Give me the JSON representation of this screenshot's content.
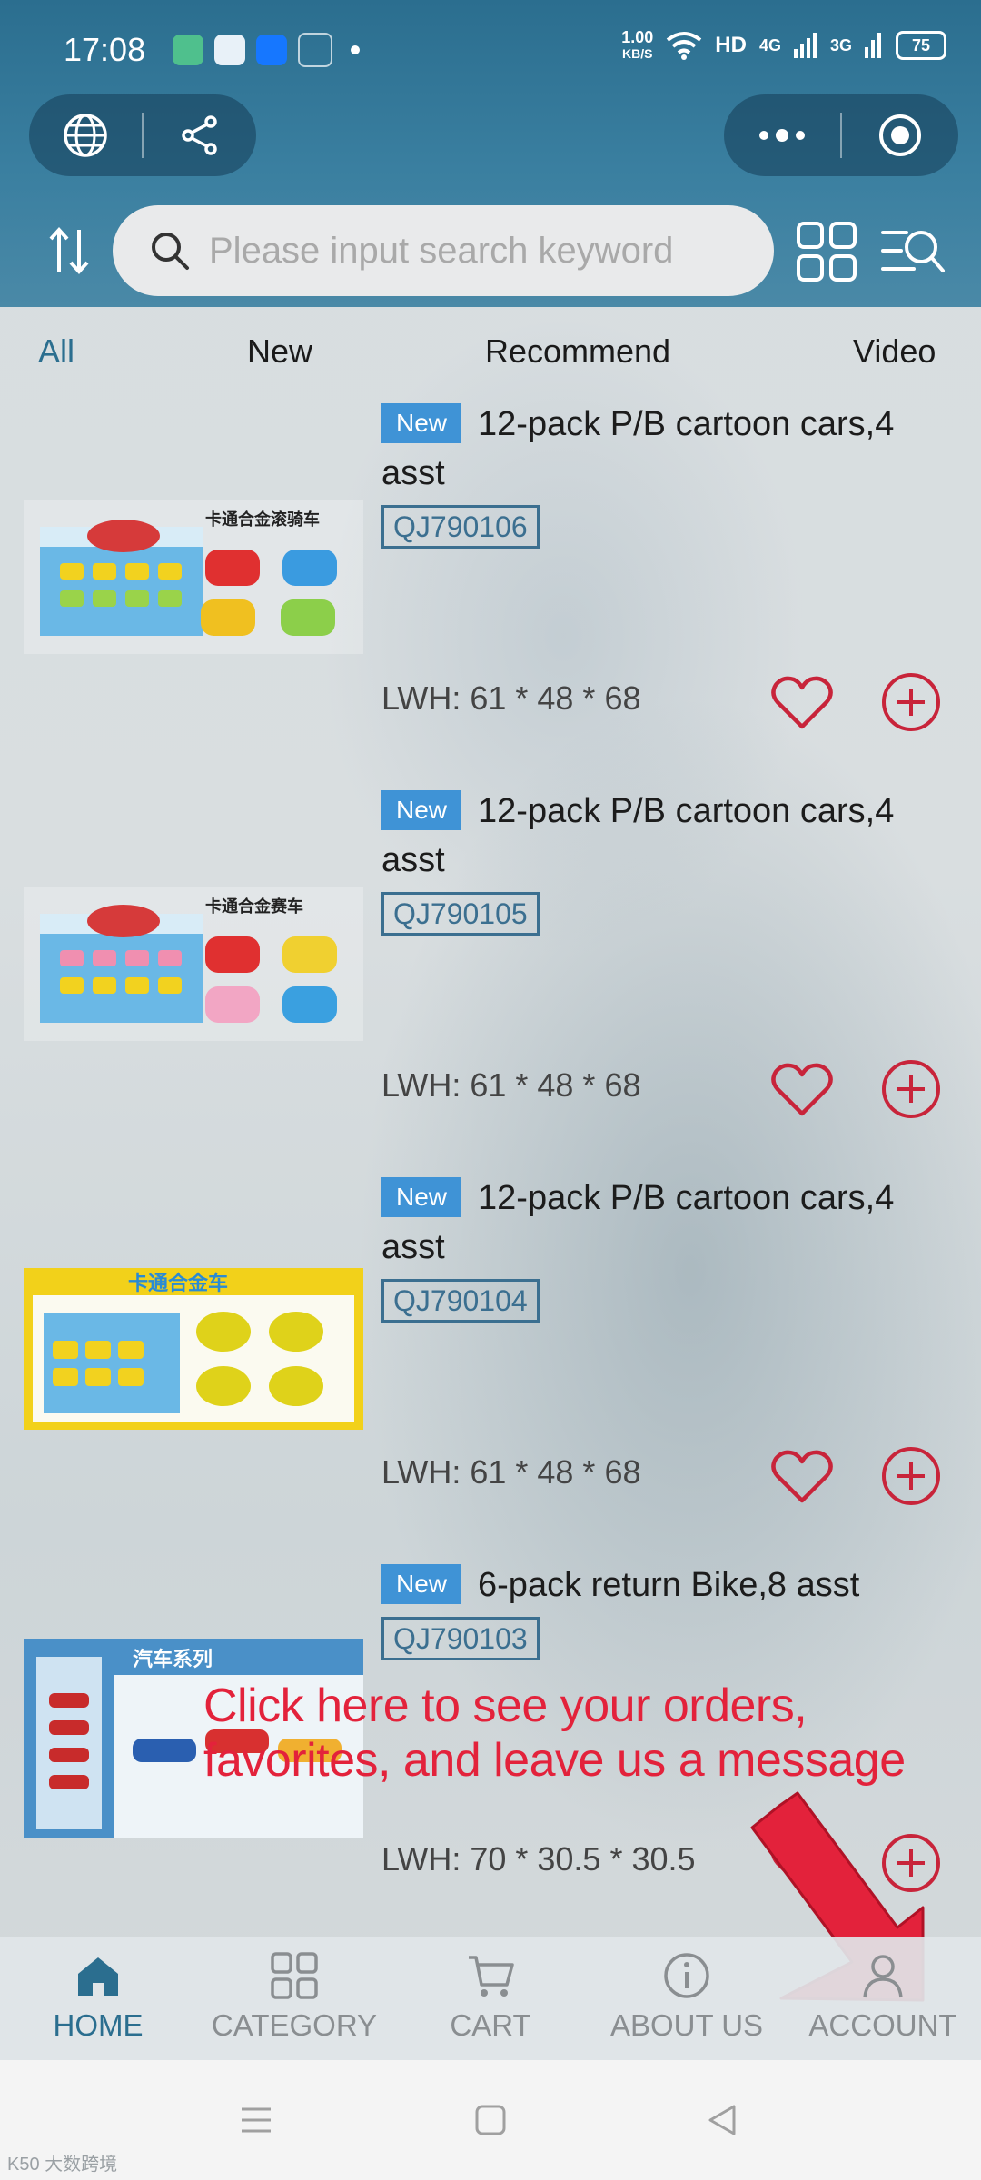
{
  "status_bar": {
    "time": "17:08",
    "speed_value": "1.00",
    "speed_unit": "KB/S",
    "network_hd": "HD",
    "network_4g": "4G",
    "network_3g": "3G",
    "battery": "75"
  },
  "search": {
    "placeholder": "Please input search keyword"
  },
  "tabs": [
    {
      "label": "All",
      "active": true
    },
    {
      "label": "New"
    },
    {
      "label": "Recommend"
    },
    {
      "label": "Video"
    }
  ],
  "products": [
    {
      "badge": "New",
      "title": "12-pack P/B cartoon cars,4 asst",
      "sku": "QJ790106",
      "lwh": "LWH: 61 * 48 * 68"
    },
    {
      "badge": "New",
      "title": "12-pack P/B cartoon cars,4 asst",
      "sku": "QJ790105",
      "lwh": "LWH: 61 * 48 * 68"
    },
    {
      "badge": "New",
      "title": "12-pack P/B cartoon cars,4 asst",
      "sku": "QJ790104",
      "lwh": "LWH: 61 * 48 * 68"
    },
    {
      "badge": "New",
      "title": "6-pack return Bike,8 asst",
      "sku": "QJ790103",
      "lwh": "LWH: 70 * 30.5 * 30.5"
    }
  ],
  "annotation": {
    "line1": "Click here to see your orders,",
    "line2": "favorites, and leave us a message"
  },
  "tabbar": [
    {
      "label": "HOME",
      "icon": "home-icon",
      "active": true
    },
    {
      "label": "CATEGORY",
      "icon": "category-icon"
    },
    {
      "label": "CART",
      "icon": "cart-icon"
    },
    {
      "label": "ABOUT US",
      "icon": "info-icon"
    },
    {
      "label": "ACCOUNT",
      "icon": "account-icon"
    }
  ],
  "colors": {
    "header": "#2b6e8f",
    "accent": "#2b6e8f",
    "badge": "#3f93d6",
    "action_red": "#c8243a",
    "annotation_red": "#e3223b"
  },
  "watermark": "K50 大数跨境"
}
